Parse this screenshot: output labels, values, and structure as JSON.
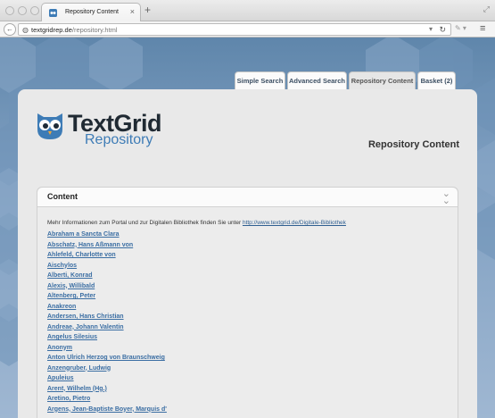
{
  "browser": {
    "tab_title": "Repository Content",
    "url_host": "textgridrep.de",
    "url_path": "/repository.html"
  },
  "nav": {
    "tabs": [
      {
        "label": "Simple Search"
      },
      {
        "label": "Advanced Search"
      },
      {
        "label": "Repository Content"
      },
      {
        "label": "Basket (2)"
      }
    ]
  },
  "logo": {
    "title": "TextGrid",
    "subtitle": "Repository"
  },
  "page": {
    "heading": "Repository Content"
  },
  "content": {
    "title": "Content",
    "info_text": "Mehr Informationen zum Portal und zur Digitalen Bibliothek finden Sie unter ",
    "info_link": "http://www.textgrid.de/Digitale-Bibliothek",
    "authors": [
      "Abraham a Sancta Clara",
      "Abschatz, Hans Aßmann von",
      "Ahlefeld, Charlotte von",
      "Aischylos",
      "Alberti, Konrad",
      "Alexis, Willibald",
      "Altenberg, Peter",
      "Anakreon",
      "Andersen, Hans Christian",
      "Andreae, Johann Valentin",
      "Angelus Silesius",
      "Anonym",
      "Anton Ulrich Herzog von Braunschweig",
      "Anzengruber, Ludwig",
      "Apuleius",
      "Arent, Wilhelm (Hg.)",
      "Aretino, Pietro",
      "Argens, Jean-Baptiste Boyer, Marquis d'"
    ]
  }
}
